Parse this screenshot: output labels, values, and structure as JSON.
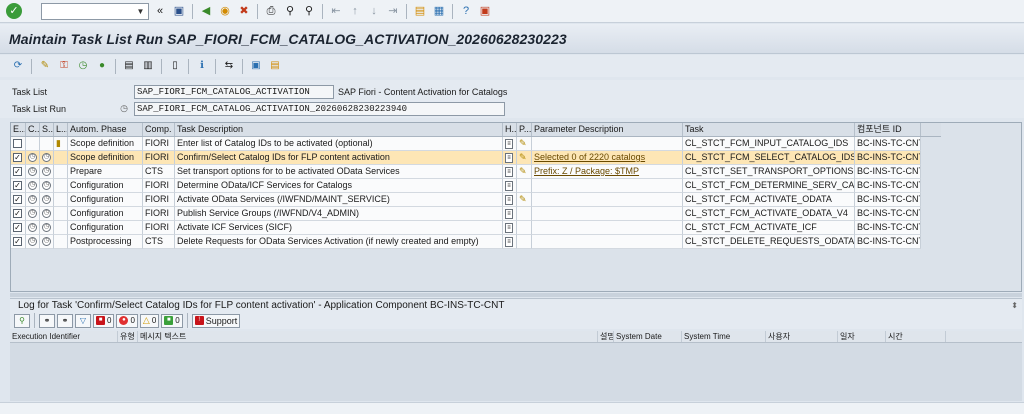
{
  "colors": {
    "accent": "#fde6b5",
    "link": "#6a4a00"
  },
  "toolbar": {
    "command_placeholder": "",
    "icons": [
      "ok-icon",
      "back-icon",
      "save-icon",
      "back-nav-icon",
      "exit-icon",
      "cancel-icon",
      "print-icon",
      "find-icon",
      "find-next-icon",
      "first-page-icon",
      "prev-page-icon",
      "next-page-icon",
      "last-page-icon",
      "new-session-icon",
      "shortcut-icon",
      "help-icon",
      "customize-layout-icon"
    ]
  },
  "title": "Maintain Task List Run SAP_FIORI_FCM_CATALOG_ACTIVATION_20260628230223",
  "form": {
    "task_list_label": "Task List",
    "task_list_value": "SAP_FIORI_FCM_CATALOG_ACTIVATION",
    "task_list_desc": "SAP Fiori - Content Activation for Catalogs",
    "task_list_run_label": "Task List Run",
    "task_list_run_value": "SAP_FIORI_FCM_CATALOG_ACTIVATION_20260628230223940"
  },
  "grid": {
    "headers": {
      "e": "E...",
      "c": "C...",
      "s": "S...",
      "l": "L...",
      "phase": "Autom. Phase",
      "comp": "Comp.",
      "desc": "Task Description",
      "h": "H...",
      "p": "P...",
      "param": "Parameter Description",
      "task": "Task",
      "compid": "컴포넌트 ID"
    },
    "rows": [
      {
        "phase": "Scope definition",
        "comp": "FIORI",
        "desc": "Enter list of Catalog IDs to be activated (optional)",
        "param": "",
        "task": "CL_STCT_FCM_INPUT_CATALOG_IDS",
        "compid": "BC-INS-TC-CNT"
      },
      {
        "phase": "Scope definition",
        "comp": "FIORI",
        "desc": "Confirm/Select Catalog IDs for FLP content activation",
        "param": "Selected 0 of 2220 catalogs",
        "task": "CL_STCT_FCM_SELECT_CATALOG_IDS",
        "compid": "BC-INS-TC-CNT"
      },
      {
        "phase": "Prepare",
        "comp": "CTS",
        "desc": "Set transport options for to be activated OData Services",
        "param": "Prefix: Z / Package: $TMP",
        "task": "CL_STCT_SET_TRANSPORT_OPTIONS",
        "compid": "BC-INS-TC-CNT"
      },
      {
        "phase": "Configuration",
        "comp": "FIORI",
        "desc": "Determine OData/ICF Services for Catalogs",
        "param": "",
        "task": "CL_STCT_FCM_DETERMINE_SERV_CAT",
        "compid": "BC-INS-TC-CNT"
      },
      {
        "phase": "Configuration",
        "comp": "FIORI",
        "desc": "Activate OData Services (/IWFND/MAINT_SERVICE)",
        "param": "",
        "task": "CL_STCT_FCM_ACTIVATE_ODATA",
        "compid": "BC-INS-TC-CNT"
      },
      {
        "phase": "Configuration",
        "comp": "FIORI",
        "desc": "Publish Service Groups (/IWFND/V4_ADMIN)",
        "param": "",
        "task": "CL_STCT_FCM_ACTIVATE_ODATA_V4",
        "compid": "BC-INS-TC-CNT"
      },
      {
        "phase": "Configuration",
        "comp": "FIORI",
        "desc": "Activate ICF Services (SICF)",
        "param": "",
        "task": "CL_STCT_FCM_ACTIVATE_ICF",
        "compid": "BC-INS-TC-CNT"
      },
      {
        "phase": "Postprocessing",
        "comp": "CTS",
        "desc": "Delete Requests for OData Services Activation (if newly created and empty)",
        "param": "",
        "task": "CL_STCT_DELETE_REQUESTS_ODATA",
        "compid": "BC-INS-TC-CNT"
      }
    ]
  },
  "log": {
    "title": "Log for Task 'Confirm/Select Catalog IDs for FLP content activation' - Application Component BC-INS-TC-CNT",
    "counts": {
      "stop": "0",
      "error": "0",
      "warning": "0",
      "info": "0"
    },
    "support_label": "Support",
    "headers": {
      "exec_id": "Execution Identifier",
      "type": "유형",
      "msg": "메시지 텍스트",
      "desc": "설명",
      "sysdate": "System Date",
      "systime": "System Time",
      "user": "사용자",
      "date": "일자",
      "time": "시간"
    }
  }
}
